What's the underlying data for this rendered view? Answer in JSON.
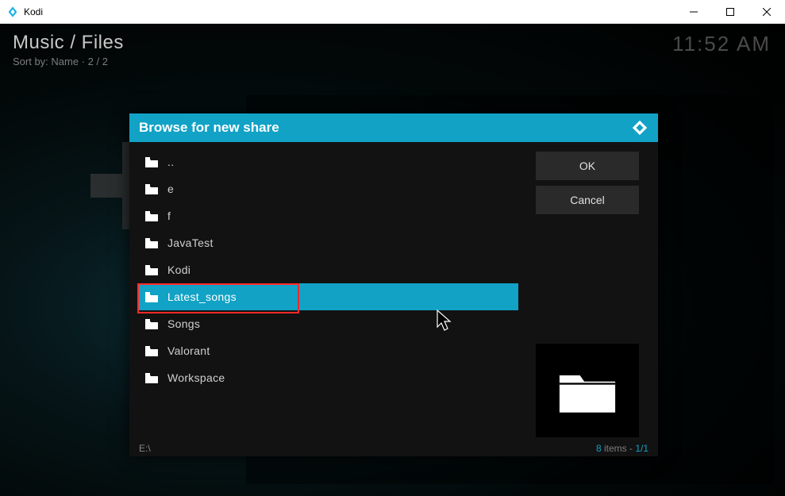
{
  "window": {
    "title": "Kodi"
  },
  "header": {
    "breadcrumb": "Music / Files",
    "sortby_label": "Sort by: Name",
    "position": "2 / 2",
    "clock": "11:52 AM"
  },
  "dialog": {
    "title": "Browse for new share",
    "items": [
      {
        "label": "..",
        "selected": false,
        "highlighted": false
      },
      {
        "label": "e",
        "selected": false,
        "highlighted": false
      },
      {
        "label": "f",
        "selected": false,
        "highlighted": false
      },
      {
        "label": "JavaTest",
        "selected": false,
        "highlighted": false
      },
      {
        "label": "Kodi",
        "selected": false,
        "highlighted": false
      },
      {
        "label": "Latest_songs",
        "selected": true,
        "highlighted": true
      },
      {
        "label": "Songs",
        "selected": false,
        "highlighted": false
      },
      {
        "label": "Valorant",
        "selected": false,
        "highlighted": false
      },
      {
        "label": "Workspace",
        "selected": false,
        "highlighted": false
      }
    ],
    "ok_label": "OK",
    "cancel_label": "Cancel",
    "footer": {
      "path": "E:\\",
      "count": "8",
      "items_label": " items - ",
      "page": "1/1"
    }
  }
}
